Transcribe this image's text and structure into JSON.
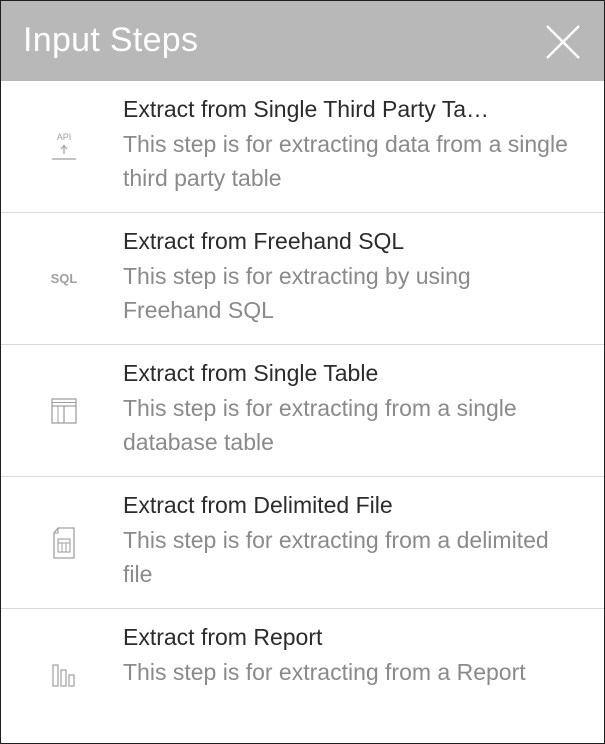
{
  "header": {
    "title": "Input Steps",
    "close_icon": "close-icon"
  },
  "steps": [
    {
      "icon": "api-icon",
      "icon_text": "API",
      "title": "Extract from Single Third Party Ta…",
      "description": "This step is for extracting data from a single third party table"
    },
    {
      "icon": "sql-icon",
      "icon_text": "SQL",
      "title": "Extract from Freehand SQL",
      "description": "This step is for extracting by using Freehand SQL"
    },
    {
      "icon": "table-icon",
      "title": "Extract from Single Table",
      "description": "This step is for extracting from a single database table"
    },
    {
      "icon": "delimited-file-icon",
      "title": "Extract from Delimited File",
      "description": "This step is for extracting from a delimited file"
    },
    {
      "icon": "report-icon",
      "title": "Extract from Report",
      "description": "This step is for extracting from a Report"
    }
  ],
  "colors": {
    "header_bg": "#b8b8b8",
    "title_text": "#2b2b2b",
    "desc_text": "#8a8a8a",
    "icon": "#a0a0a0"
  }
}
